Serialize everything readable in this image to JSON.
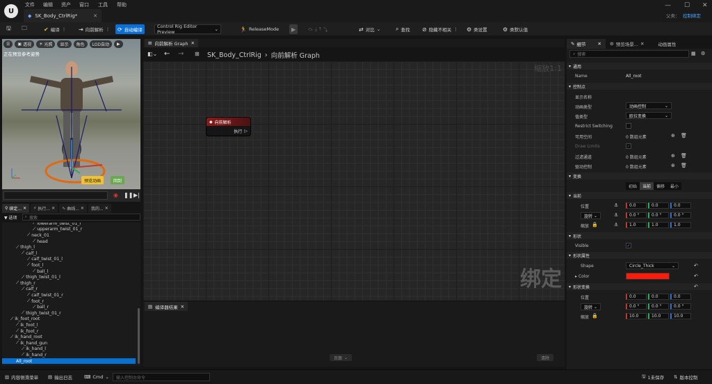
{
  "titlebar": {
    "menus": [
      "文件",
      "编辑",
      "资产",
      "窗口",
      "工具",
      "帮助"
    ],
    "document_tab": "SK_Body_CtrlRig*",
    "parent_label": "父类：",
    "parent_value": "控制绑定"
  },
  "toolbar": {
    "compile": "编译",
    "forward_solve": "向前解析",
    "auto_compile": "自动编译",
    "preview_mode": "Control Rig Editor Preview",
    "release_mode": "ReleaseMode",
    "diff": "对比",
    "find": "查找",
    "hide_unrelated": "隐藏不相关",
    "class_settings": "类设置",
    "class_defaults": "类默认值"
  },
  "viewport": {
    "buttons": [
      "透视",
      "光照",
      "显示",
      "角色",
      "LOD自动"
    ],
    "status": "正在预览参考姿势",
    "preview_anim": "预览动画",
    "reset": "回到"
  },
  "left_tabs": [
    "绑定...",
    "执行...",
    "曲线...",
    "我的..."
  ],
  "hierarchy": {
    "filter": "选项",
    "search_placeholder": "搜索",
    "items": [
      {
        "label": "lowerarm_twist_01_r",
        "depth": 5
      },
      {
        "label": "upperarm_twist_01_r",
        "depth": 5
      },
      {
        "label": "neck_01",
        "depth": 4
      },
      {
        "label": "head",
        "depth": 5
      },
      {
        "label": "thigh_l",
        "depth": 2
      },
      {
        "label": "calf_l",
        "depth": 3
      },
      {
        "label": "calf_twist_01_l",
        "depth": 4
      },
      {
        "label": "foot_l",
        "depth": 4
      },
      {
        "label": "ball_l",
        "depth": 5
      },
      {
        "label": "thigh_twist_01_l",
        "depth": 3
      },
      {
        "label": "thigh_r",
        "depth": 2
      },
      {
        "label": "calf_r",
        "depth": 3
      },
      {
        "label": "calf_twist_01_r",
        "depth": 4
      },
      {
        "label": "foot_r",
        "depth": 4
      },
      {
        "label": "ball_r",
        "depth": 5
      },
      {
        "label": "thigh_twist_01_r",
        "depth": 3
      },
      {
        "label": "ik_foot_root",
        "depth": 1
      },
      {
        "label": "ik_foot_l",
        "depth": 2
      },
      {
        "label": "ik_foot_r",
        "depth": 2
      },
      {
        "label": "ik_hand_root",
        "depth": 1
      },
      {
        "label": "ik_hand_gun",
        "depth": 2
      },
      {
        "label": "ik_hand_l",
        "depth": 3
      },
      {
        "label": "ik_hand_r",
        "depth": 3
      },
      {
        "label": "All_root",
        "depth": 1,
        "selected": true
      }
    ]
  },
  "graph": {
    "tab": "向前解析 Graph",
    "breadcrumb_root": "SK_Body_CtrlRig",
    "breadcrumb_leaf": "向前解析 Graph",
    "zoom": "缩放1:1",
    "watermark": "绑定",
    "node_title": "向前解析",
    "node_pin": "执行"
  },
  "compiler": {
    "tab": "编译器结果",
    "page": "页面",
    "clear": "清除"
  },
  "details": {
    "tabs": [
      "细节",
      "预览场景...",
      "动画属性"
    ],
    "search_placeholder": "搜索",
    "sections": {
      "general": "通用",
      "control": "控制点",
      "transform": "变换",
      "current": "当前",
      "shape": "形状",
      "shape_props": "形状属性",
      "shape_transform": "形状变换"
    },
    "name_label": "Name",
    "name_value": "All_root",
    "display_name": "显示名称",
    "anim_type_label": "动画类型",
    "anim_type_value": "动画控制",
    "value_type_label": "值类型",
    "value_type_value": "欧拉变换",
    "restrict_switching": "Restrict Switching",
    "available_spaces": "可用空间",
    "available_spaces_value": "0 数组元素",
    "draw_limits": "Draw Limits",
    "filtered_channels": "过滤通道",
    "filtered_channels_value": "0 数组元素",
    "driven_controls": "驱动控制",
    "driven_controls_value": "0 数组元素",
    "transform_modes": [
      "初始",
      "当前",
      "偏移",
      "最小"
    ],
    "location": "位置",
    "rotation": "旋转",
    "scale": "缩放",
    "loc_values": [
      "0.0",
      "0.0",
      "0.0"
    ],
    "rot_values": [
      "0.0 °",
      "0.0 °",
      "0.0 °"
    ],
    "scale_values": [
      "1.0",
      "1.0",
      "1.0"
    ],
    "visible": "Visible",
    "shape_label": "Shape",
    "shape_value": "Circle_Thick",
    "color_label": "Color",
    "color_value": "#ff1a0a",
    "shape_loc_values": [
      "0.0",
      "0.0",
      "0.0"
    ],
    "shape_rot_values": [
      "0.0 °",
      "0.0 °",
      "0.0 °"
    ],
    "shape_scale_values": [
      "10.0",
      "10.0",
      "10.0"
    ]
  },
  "statusbar": {
    "content_drawer": "内容侧滑菜单",
    "output_log": "输出日志",
    "cmd": "Cmd",
    "cmd_placeholder": "输入控制台命令",
    "unsaved": "1未保存",
    "source_control": "版本控制"
  }
}
